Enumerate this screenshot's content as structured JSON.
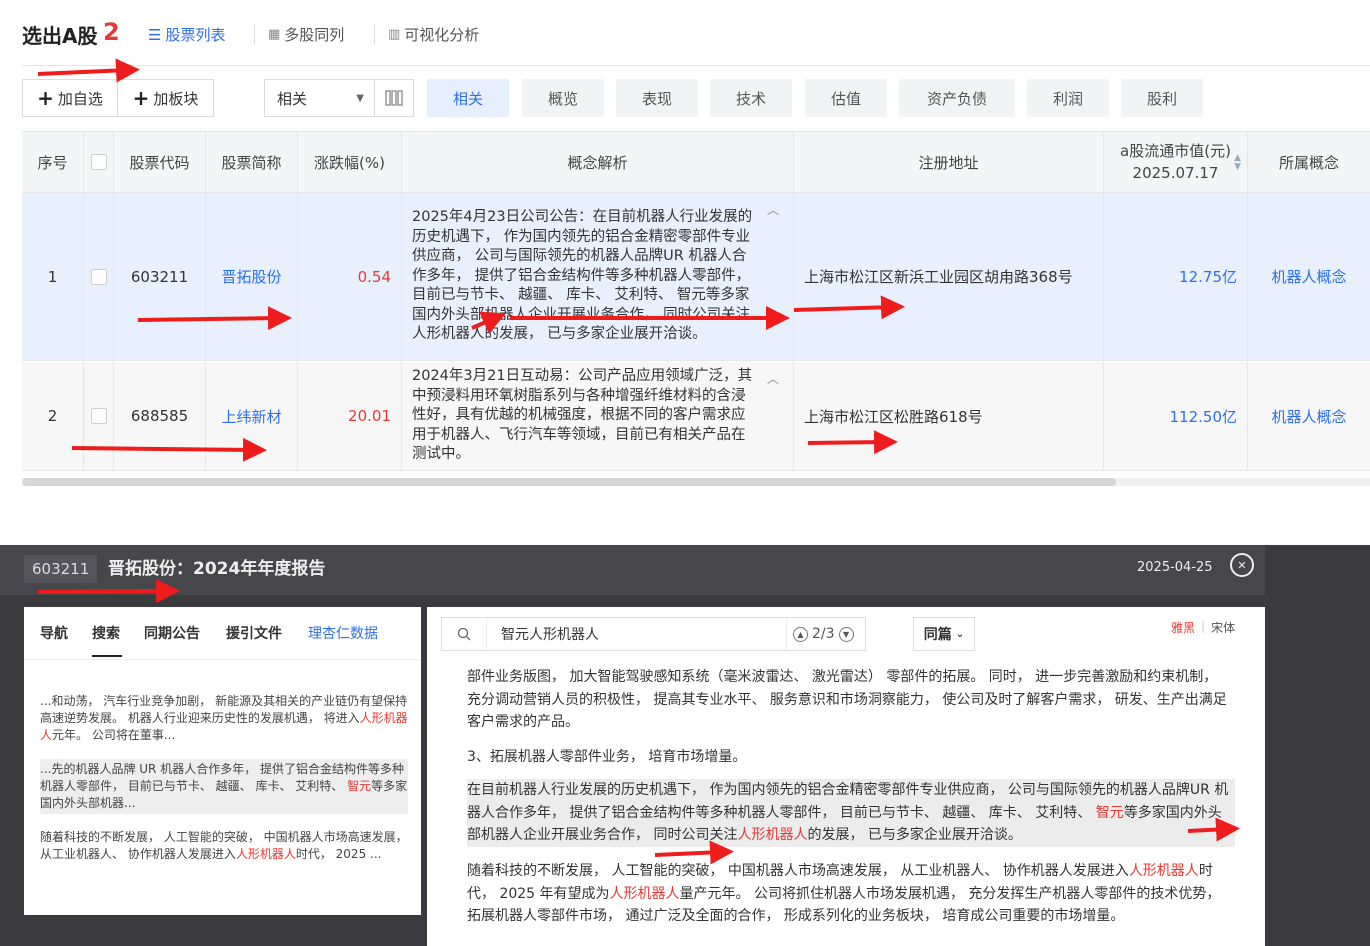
{
  "toolbar": {
    "title": "选出A股",
    "count": "2",
    "tabs": [
      "股票列表",
      "多股同列",
      "可视化分析"
    ],
    "add_watch": "加自选",
    "add_block": "加板块",
    "select_value": "相关",
    "chips": [
      "相关",
      "概览",
      "表现",
      "技术",
      "估值",
      "资产负债",
      "利润",
      "股利"
    ]
  },
  "table": {
    "headers": [
      "序号",
      "股票代码",
      "股票简称",
      "涨跌幅(%)",
      "概念解析",
      "注册地址",
      "a股流通市值(元)",
      "2025.07.17",
      "所属概念"
    ],
    "rows": [
      {
        "index": "1",
        "code": "603211",
        "name": "晋拓股份",
        "change": "0.54",
        "concept": "2025年4月23日公司公告：在目前机器人行业发展的历史机遇下， 作为国内领先的铝合金精密零部件专业供应商， 公司与国际领先的机器人品牌UR 机器人合作多年， 提供了铝合金结构件等多种机器人零部件， 目前已与节卡、 越疆、 库卡、 艾利特、 智元等多家国内外头部机器人企业开展业务合作， 同时公司关注人形机器人的发展， 已与多家企业展开洽谈。",
        "address": "上海市松江区新浜工业园区胡甪路368号",
        "cap": "12.75亿",
        "category": "机器人概念"
      },
      {
        "index": "2",
        "code": "688585",
        "name": "上纬新材",
        "change": "20.01",
        "concept": "2024年3月21日互动易：公司产品应用领域广泛，其中预浸料用环氧树脂系列与各种增强纤维材料的含浸性好，具有优越的机械强度，根据不同的客户需求应用于机器人、飞行汽车等领域，目前已有相关产品在测试中。",
        "address": "上海市松江区松胜路618号",
        "cap": "112.50亿",
        "category": "机器人概念"
      }
    ]
  },
  "doc": {
    "code": "603211",
    "title": "晋拓股份：2024年年度报告",
    "date": "2025-04-25",
    "nav_tabs": [
      "导航",
      "搜索",
      "同期公告",
      "援引文件",
      "理杏仁数据"
    ],
    "snippets": [
      {
        "pre": "...和动荡， 汽车行业竞争加剧， 新能源及其相关的产业链仍有望保持高速逆势发展。 机器人行业迎来历史性的发展机遇， 将进入",
        "kw": "人形机器人",
        "post": "元年。 公司将在董事..."
      },
      {
        "pre": "...先的机器人品牌 UR 机器人合作多年， 提供了铝合金结构件等多种机器人零部件， 目前已与节卡、 越疆、 库卡、 艾利特、 ",
        "kw": "智元",
        "post": "等多家国内外头部机器..."
      },
      {
        "pre": "随着科技的不断发展， 人工智能的突破， 中国机器人市场高速发展， 从工业机器人、 协作机器人发展进入",
        "kw": "人形机器人",
        "post": "时代， 2025 ..."
      }
    ],
    "search_query": "智元人形机器人",
    "match_pos": "2/3",
    "scope": "同篇",
    "font_opts": [
      "雅黑",
      "宋体"
    ],
    "paragraphs": [
      {
        "pre": "部件业务版图， 加大智能驾驶感知系统（毫米波雷达、 激光雷达） 零部件的拓展。 同时， 进一步完善激励和约束机制， 充分调动营销人员的积极性， 提高其专业水平、 服务意识和市场洞察能力， 使公司及时了解客户需求， 研发、生产出满足客户需求的产品。",
        "kw": "",
        "mid": "",
        "kw2": "",
        "post": ""
      },
      {
        "pre": "3、拓展机器人零部件业务， 培育市场增量。",
        "kw": "",
        "mid": "",
        "kw2": "",
        "post": ""
      },
      {
        "pre": "在目前机器人行业发展的历史机遇下， 作为国内领先的铝合金精密零部件专业供应商， 公司与国际领先的机器人品牌UR 机器人合作多年， 提供了铝合金结构件等多种机器人零部件， 目前已与节卡、 越疆、 库卡、 艾利特、 ",
        "kw": "智元",
        "mid": "等多家国内外头部机器人企业开展业务合作， 同时公司关注",
        "kw2": "人形机器人",
        "post": "的发展， 已与多家企业展开洽谈。"
      },
      {
        "pre": "随着科技的不断发展， 人工智能的突破， 中国机器人市场高速发展， 从工业机器人、 协作机器人发展进入",
        "kw": "人形机器人",
        "mid": "时代， 2025 年有望成为",
        "kw2": "人形机器人",
        "post": "量产元年。 公司将抓住机器人市场发展机遇， 充分发挥生产机器人零部件的技术优势， 拓展机器人零部件市场， 通过广泛及全面的合作， 形成系列化的业务板块， 培育成公司重要的市场增量。"
      }
    ]
  },
  "colors": {
    "accent": "#2d6fe8",
    "red": "#e53935",
    "row_highlight": "#e8f0fd",
    "arrow": "#ee1c1c"
  }
}
